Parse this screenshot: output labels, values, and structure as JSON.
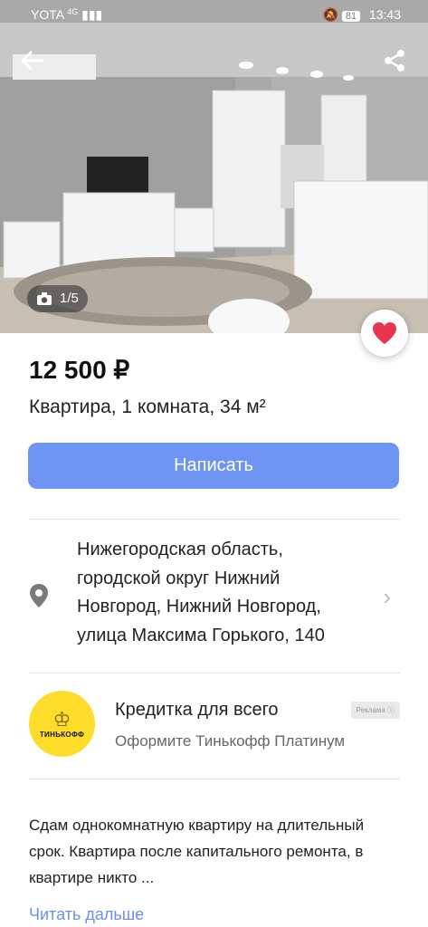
{
  "status_bar": {
    "carrier": "YOTA",
    "network": "4G",
    "battery": "81",
    "time": "13:43"
  },
  "gallery": {
    "counter": "1/5",
    "current_photo": 1,
    "total_photos": 5
  },
  "icons": {
    "back": "back-arrow-icon",
    "share": "share-icon",
    "camera": "camera-icon",
    "favorite": "heart-icon",
    "location": "location-pin-icon",
    "chevron": "chevron-right-icon"
  },
  "listing": {
    "price": "12 500 ₽",
    "title": "Квартира, 1 комната, 34 м²",
    "write_button": "Написать",
    "address": "Нижегородская область, городской округ Нижний Новгород, Нижний Новгород, улица Максима Горького, 140",
    "description": "Сдам однокомнатную квартиру на длительный срок. Квартира после капитального ремонта, в квартире никто ...",
    "read_more": "Читать дальше"
  },
  "ad": {
    "logo_text": "ТИНЬКОФФ",
    "headline": "Кредитка для всего",
    "subtitle": "Оформите Тинькофф Платинум",
    "badge": "Реклама"
  },
  "colors": {
    "accent": "#6e95f3",
    "heart": "#e8344e",
    "link": "#6b8fe8",
    "ad_logo_bg": "#fddd2a"
  }
}
